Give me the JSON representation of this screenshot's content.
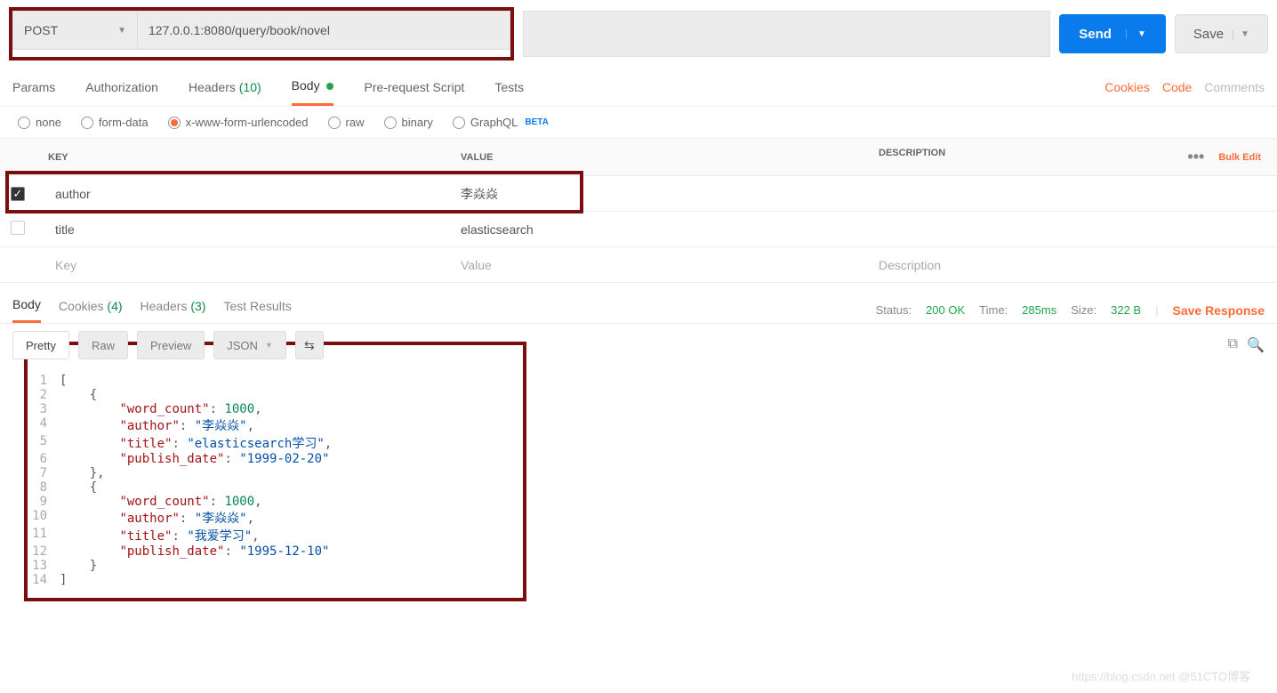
{
  "request": {
    "method": "POST",
    "url": "127.0.0.1:8080/query/book/novel",
    "send_label": "Send",
    "save_label": "Save"
  },
  "tabs": {
    "params": "Params",
    "authorization": "Authorization",
    "headers": "Headers",
    "headers_count": "(10)",
    "body": "Body",
    "prerequest": "Pre-request Script",
    "tests": "Tests",
    "cookies": "Cookies",
    "code": "Code",
    "comments": "Comments"
  },
  "body_types": {
    "none": "none",
    "formdata": "form-data",
    "xwww": "x-www-form-urlencoded",
    "raw": "raw",
    "binary": "binary",
    "graphql": "GraphQL",
    "beta": "BETA"
  },
  "kv": {
    "head_key": "KEY",
    "head_value": "VALUE",
    "head_desc": "DESCRIPTION",
    "bulk": "Bulk Edit",
    "rows": [
      {
        "enabled": true,
        "key": "author",
        "value": "李焱焱",
        "desc": ""
      },
      {
        "enabled": false,
        "key": "title",
        "value": "elasticsearch",
        "desc": ""
      }
    ],
    "ph_key": "Key",
    "ph_value": "Value",
    "ph_desc": "Description"
  },
  "response": {
    "tab_body": "Body",
    "tab_cookies": "Cookies",
    "cookies_count": "(4)",
    "tab_headers": "Headers",
    "headers_count": "(3)",
    "tab_tests": "Test Results",
    "status_label": "Status:",
    "status_value": "200 OK",
    "time_label": "Time:",
    "time_value": "285ms",
    "size_label": "Size:",
    "size_value": "322 B",
    "save_response": "Save Response"
  },
  "resp_toolbar": {
    "pretty": "Pretty",
    "raw": "Raw",
    "preview": "Preview",
    "lang": "JSON"
  },
  "json_body": [
    {
      "word_count": 1000,
      "author": "李焱焱",
      "title": "elasticsearch学习",
      "publish_date": "1999-02-20"
    },
    {
      "word_count": 1000,
      "author": "李焱焱",
      "title": "我爱学习",
      "publish_date": "1995-12-10"
    }
  ],
  "watermark": "https://blog.csdn.net @51CTO博客"
}
